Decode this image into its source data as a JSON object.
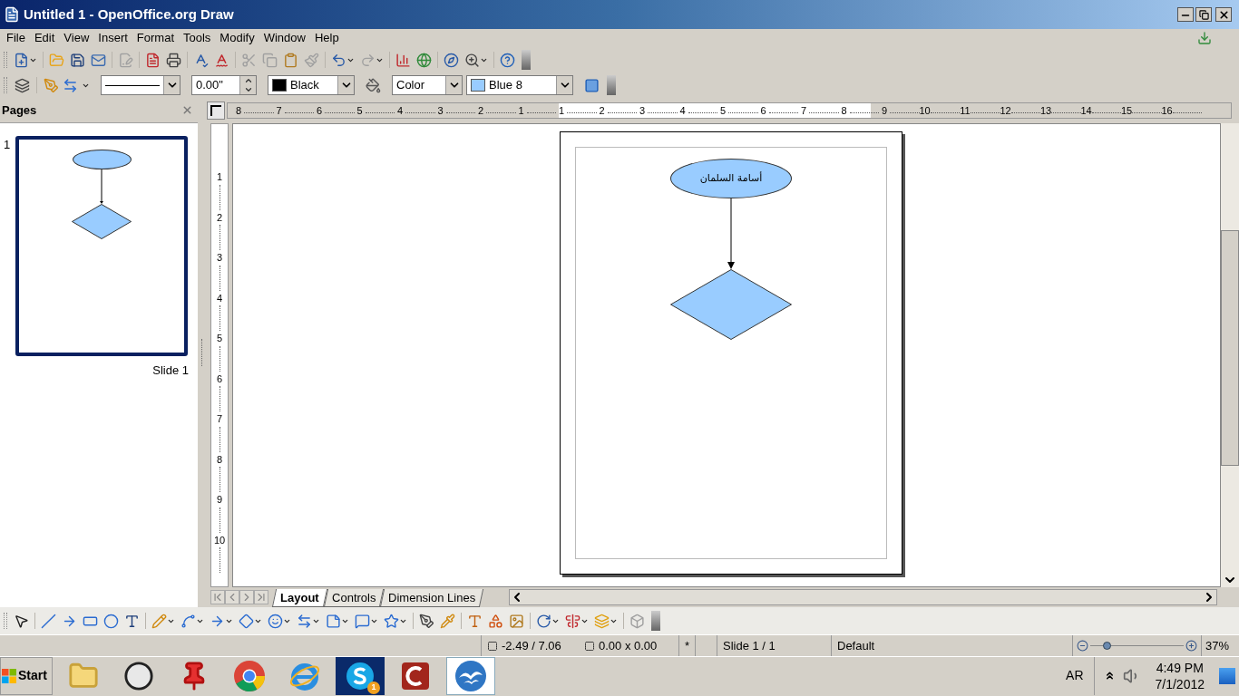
{
  "window": {
    "title": "Untitled 1 - OpenOffice.org Draw"
  },
  "menu": [
    "File",
    "Edit",
    "View",
    "Insert",
    "Format",
    "Tools",
    "Modify",
    "Window",
    "Help"
  ],
  "line_toolbar": {
    "line_width": "0.00\"",
    "line_color": {
      "label": "Black",
      "color": "#000000"
    },
    "area_style": "Color",
    "area_fill": {
      "label": "Blue 8",
      "color": "#99ccff"
    }
  },
  "pages_panel": {
    "title": "Pages",
    "pages": [
      {
        "number": "1",
        "label": "Slide 1",
        "selected": true
      }
    ]
  },
  "rulers": {
    "horizontal": [
      "8",
      "7",
      "6",
      "5",
      "4",
      "3",
      "2",
      "1",
      "1",
      "2",
      "3",
      "4",
      "5",
      "6",
      "7",
      "8",
      "9",
      "10",
      "11",
      "12",
      "13",
      "14",
      "15",
      "16"
    ],
    "vertical": [
      "1",
      "2",
      "3",
      "4",
      "5",
      "6",
      "7",
      "8",
      "9",
      "10"
    ]
  },
  "canvas": {
    "shapes": [
      {
        "kind": "ellipse",
        "text": "أسامة السلمان"
      },
      {
        "kind": "connector"
      },
      {
        "kind": "diamond"
      }
    ]
  },
  "layer_tabs": [
    {
      "label": "Layout",
      "selected": true
    },
    {
      "label": "Controls",
      "selected": false
    },
    {
      "label": "Dimension Lines",
      "selected": false
    }
  ],
  "status_bar": {
    "position": "-2.49 / 7.06",
    "size": "0.00 x 0.00",
    "modified": "*",
    "slide": "Slide 1 / 1",
    "layout": "Default",
    "zoom": {
      "level": 0.17
    },
    "zoom_percent": "37%"
  },
  "taskbar": {
    "start": "Start",
    "apps": [
      {
        "kind": "folder",
        "selected": false
      },
      {
        "kind": "clock",
        "selected": false
      },
      {
        "kind": "pin",
        "selected": false
      },
      {
        "kind": "chrome",
        "selected": false
      },
      {
        "kind": "ie",
        "selected": false
      },
      {
        "kind": "skype",
        "selected": false,
        "badge": "1"
      },
      {
        "kind": "ccleaner",
        "selected": false
      },
      {
        "kind": "openoffice",
        "selected": true
      }
    ],
    "language": "AR",
    "time": "4:49 PM",
    "date": "7/1/2012"
  }
}
